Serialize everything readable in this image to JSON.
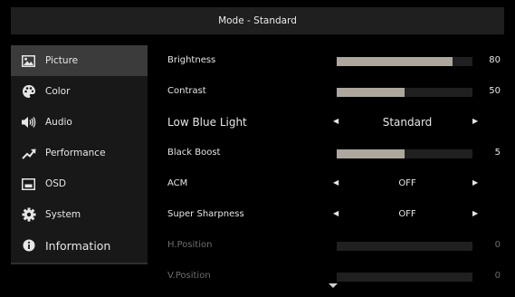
{
  "header": {
    "title": "Mode - Standard"
  },
  "sidebar": {
    "items": [
      {
        "label": "Picture",
        "icon": "picture-icon",
        "active": true
      },
      {
        "label": "Color",
        "icon": "palette-icon",
        "active": false
      },
      {
        "label": "Audio",
        "icon": "speaker-icon",
        "active": false
      },
      {
        "label": "Performance",
        "icon": "trending-up-icon",
        "active": false
      },
      {
        "label": "OSD",
        "icon": "osd-icon",
        "active": false
      },
      {
        "label": "System",
        "icon": "gear-icon",
        "active": false
      },
      {
        "label": "Information",
        "icon": "info-icon",
        "active": false
      }
    ]
  },
  "settings": {
    "brightness": {
      "label": "Brightness",
      "value": "80",
      "level": 0.85
    },
    "contrast": {
      "label": "Contrast",
      "value": "50",
      "level": 0.5
    },
    "low_blue_light": {
      "label": "Low Blue Light",
      "value": "Standard"
    },
    "black_boost": {
      "label": "Black Boost",
      "value": "5",
      "level": 0.5
    },
    "acm": {
      "label": "ACM",
      "value": "OFF"
    },
    "super_sharpness": {
      "label": "Super Sharpness",
      "value": "OFF"
    },
    "h_position": {
      "label": "H.Position",
      "value": "0",
      "level": 0
    },
    "v_position": {
      "label": "V.Position",
      "value": "0",
      "level": 0
    }
  },
  "colors": {
    "bar_fill": "#ada79e",
    "active_item_bg": "#3b3b3b",
    "disabled_text": "#6d6d6d"
  }
}
